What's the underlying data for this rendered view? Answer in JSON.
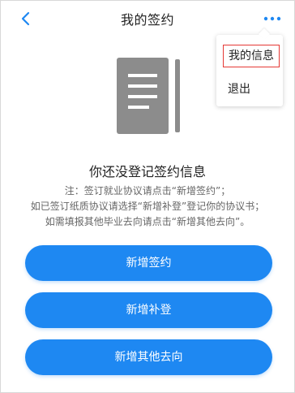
{
  "header": {
    "title": "我的签约",
    "back_icon": "chevron-left-icon",
    "more_icon": "more-dots-icon"
  },
  "menu": {
    "items": [
      {
        "label": "我的信息",
        "selected": true
      },
      {
        "label": "退出",
        "selected": false
      }
    ]
  },
  "empty_state": {
    "icon": "document-icon",
    "headline": "你还没登记签约信息",
    "notes": [
      "注：签订就业协议请点击“新增签约”；",
      "如已签订纸质协议请选择“新增补登”登记你的协议书；",
      "如需填报其他毕业去向请点击“新增其他去向”。"
    ]
  },
  "actions": {
    "add_contract": "新增签约",
    "add_supplement": "新增补登",
    "add_other": "新增其他去向"
  },
  "colors": {
    "accent": "#1e88f2",
    "icon_gray": "#8c8c8c",
    "highlight_border": "#e53935"
  }
}
